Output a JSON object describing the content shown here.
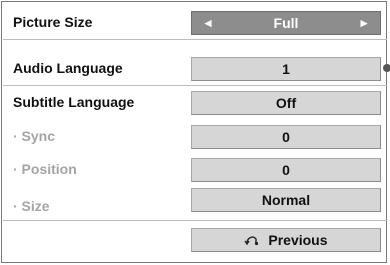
{
  "menu": {
    "rows": [
      {
        "label": "Picture Size",
        "value": "Full",
        "sub": false,
        "selected": true,
        "left_arrow": "◄",
        "right_arrow": "►"
      },
      {
        "label": "Audio Language",
        "value": "1",
        "sub": false,
        "selected": false
      },
      {
        "label": "Subtitle Language",
        "value": "Off",
        "sub": false,
        "selected": false
      },
      {
        "label": "· Sync",
        "value": "0",
        "sub": true,
        "selected": false
      },
      {
        "label": "· Position",
        "value": "0",
        "sub": true,
        "selected": false
      },
      {
        "label": "· Size",
        "value": "Normal",
        "sub": true,
        "selected": false
      }
    ],
    "previous_label": "Previous",
    "previous_icon": "return-arrow-icon"
  },
  "colors": {
    "selected_bg": "#8d8d8d",
    "box_bg": "#d6d6d6",
    "sub_label": "#a5a5a5"
  }
}
